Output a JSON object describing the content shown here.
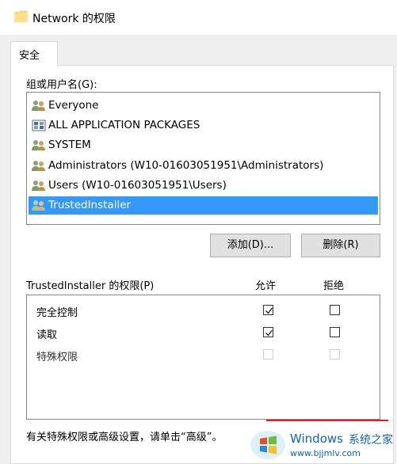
{
  "window": {
    "title": "Network 的权限"
  },
  "tabs": [
    {
      "label": "安全"
    }
  ],
  "group_label": "组或用户名(G):",
  "users": [
    {
      "name": "Everyone",
      "icon": "user-group-icon"
    },
    {
      "name": "ALL APPLICATION PACKAGES",
      "icon": "package-icon"
    },
    {
      "name": "SYSTEM",
      "icon": "user-group-icon"
    },
    {
      "name": "Administrators (W10-01603051951\\Administrators)",
      "icon": "user-group-icon"
    },
    {
      "name": "Users (W10-01603051951\\Users)",
      "icon": "user-group-icon"
    },
    {
      "name": "TrustedInstaller",
      "icon": "user-group-icon",
      "selected": true
    }
  ],
  "buttons": {
    "add": "添加(D)...",
    "remove": "删除(R)"
  },
  "permissions": {
    "header": "TrustedInstaller 的权限(P)",
    "allow_label": "允许",
    "deny_label": "拒绝",
    "rows": [
      {
        "name": "完全控制",
        "allow": true,
        "deny": false,
        "enabled": true
      },
      {
        "name": "读取",
        "allow": true,
        "deny": false,
        "enabled": true
      },
      {
        "name": "特殊权限",
        "allow": false,
        "deny": false,
        "enabled": false
      }
    ]
  },
  "footer": {
    "text": "有关特殊权限或高级设置，请单击“高级”。"
  },
  "watermark": {
    "brand": "Windows",
    "sub": "系统之家",
    "url": "www.bjjmlv.com"
  },
  "colors": {
    "selection": "#3399ff",
    "accent_red": "#e51b23",
    "watermark_blue": "#0f63b3"
  }
}
